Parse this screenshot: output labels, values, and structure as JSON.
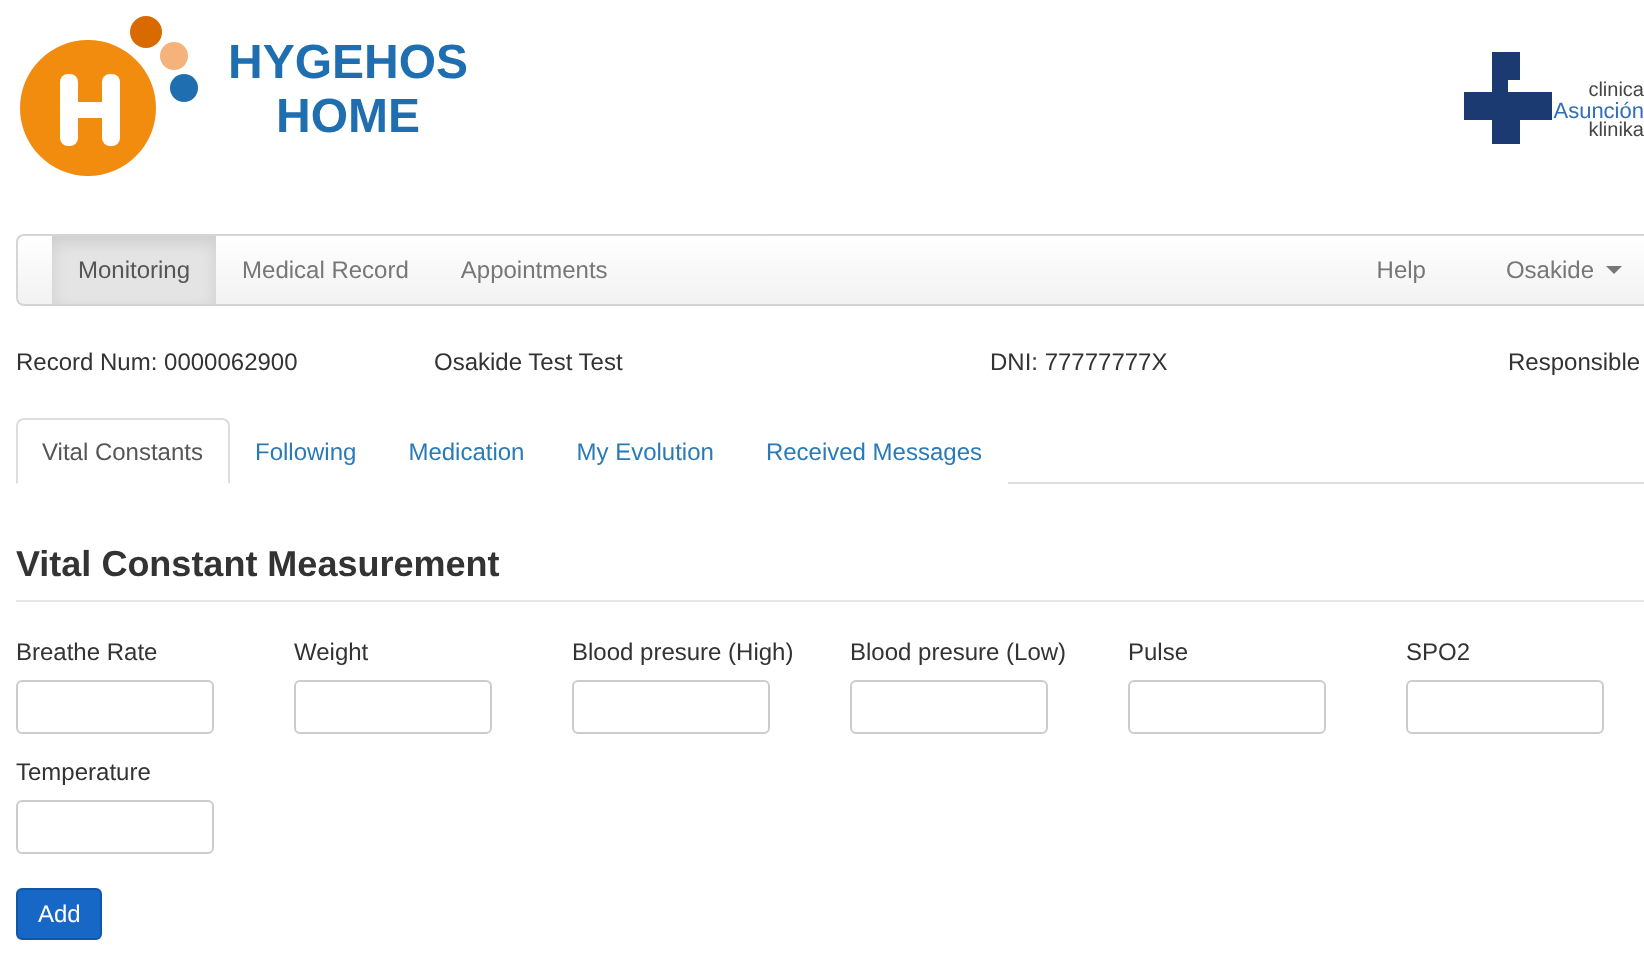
{
  "brand": {
    "line1": "HYGEHOS",
    "line2": "HOME"
  },
  "partner_logo": {
    "line1": "clinica",
    "line2": "Asunción",
    "line3": "klinika"
  },
  "navbar": {
    "left": [
      {
        "label": "Monitoring",
        "selected": true
      },
      {
        "label": "Medical Record",
        "selected": false
      },
      {
        "label": "Appointments",
        "selected": false
      }
    ],
    "right": [
      {
        "label": "Help",
        "dropdown": false
      },
      {
        "label": "Osakide",
        "dropdown": true
      }
    ]
  },
  "record": [
    "Record Num: 0000062900",
    "Osakide Test Test",
    "DNI: 77777777X",
    "Responsible"
  ],
  "tabs": [
    {
      "label": "Vital Constants",
      "selected": true
    },
    {
      "label": "Following",
      "selected": false
    },
    {
      "label": "Medication",
      "selected": false
    },
    {
      "label": "My Evolution",
      "selected": false
    },
    {
      "label": "Received Messages",
      "selected": false
    }
  ],
  "section_title": "Vital Constant Measurement",
  "fields": [
    {
      "label": "Breathe Rate"
    },
    {
      "label": "Weight"
    },
    {
      "label": "Blood presure (High)"
    },
    {
      "label": "Blood presure (Low)"
    },
    {
      "label": "Pulse"
    },
    {
      "label": "SPO2"
    },
    {
      "label": "Temperature"
    }
  ],
  "submit": "Add"
}
